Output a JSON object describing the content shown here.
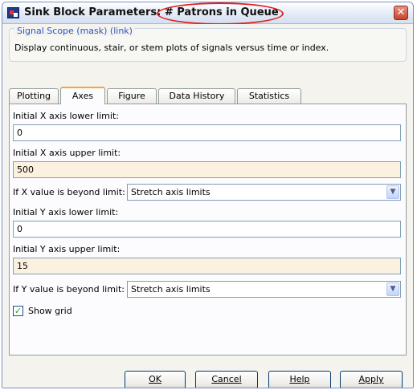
{
  "window": {
    "title_prefix": "Sink Block Parameters:",
    "title_block": "# Patrons in Queue",
    "close_glyph": "✕"
  },
  "mask": {
    "legend": "Signal Scope (mask) (link)",
    "description": "Display continuous, stair, or stem plots of signals versus time or index."
  },
  "tabs": [
    {
      "label": "Plotting",
      "active": false
    },
    {
      "label": "Axes",
      "active": true
    },
    {
      "label": "Figure",
      "active": false
    },
    {
      "label": "Data History",
      "active": false
    },
    {
      "label": "Statistics",
      "active": false
    }
  ],
  "axes": {
    "x_lower_label": "Initial X axis lower limit:",
    "x_lower_value": "0",
    "x_upper_label": "Initial X axis upper limit:",
    "x_upper_value": "500",
    "x_beyond_label": "If X value is beyond limit:",
    "x_beyond_value": "Stretch axis limits",
    "y_lower_label": "Initial Y axis lower limit:",
    "y_lower_value": "0",
    "y_upper_label": "Initial Y axis upper limit:",
    "y_upper_value": "15",
    "y_beyond_label": "If Y value is beyond limit:",
    "y_beyond_value": "Stretch axis limits",
    "show_grid_label": "Show grid",
    "show_grid_checked": true,
    "check_glyph": "✓",
    "dropdown_glyph": "▼"
  },
  "buttons": {
    "ok": "OK",
    "cancel": "Cancel",
    "help": "Help",
    "apply": "Apply"
  },
  "colors": {
    "highlight_ellipse": "#e0201a",
    "active_tab_accent": "#f8a529",
    "link_color": "#2a55c7",
    "modified_field_bg": "#fcf1de"
  }
}
